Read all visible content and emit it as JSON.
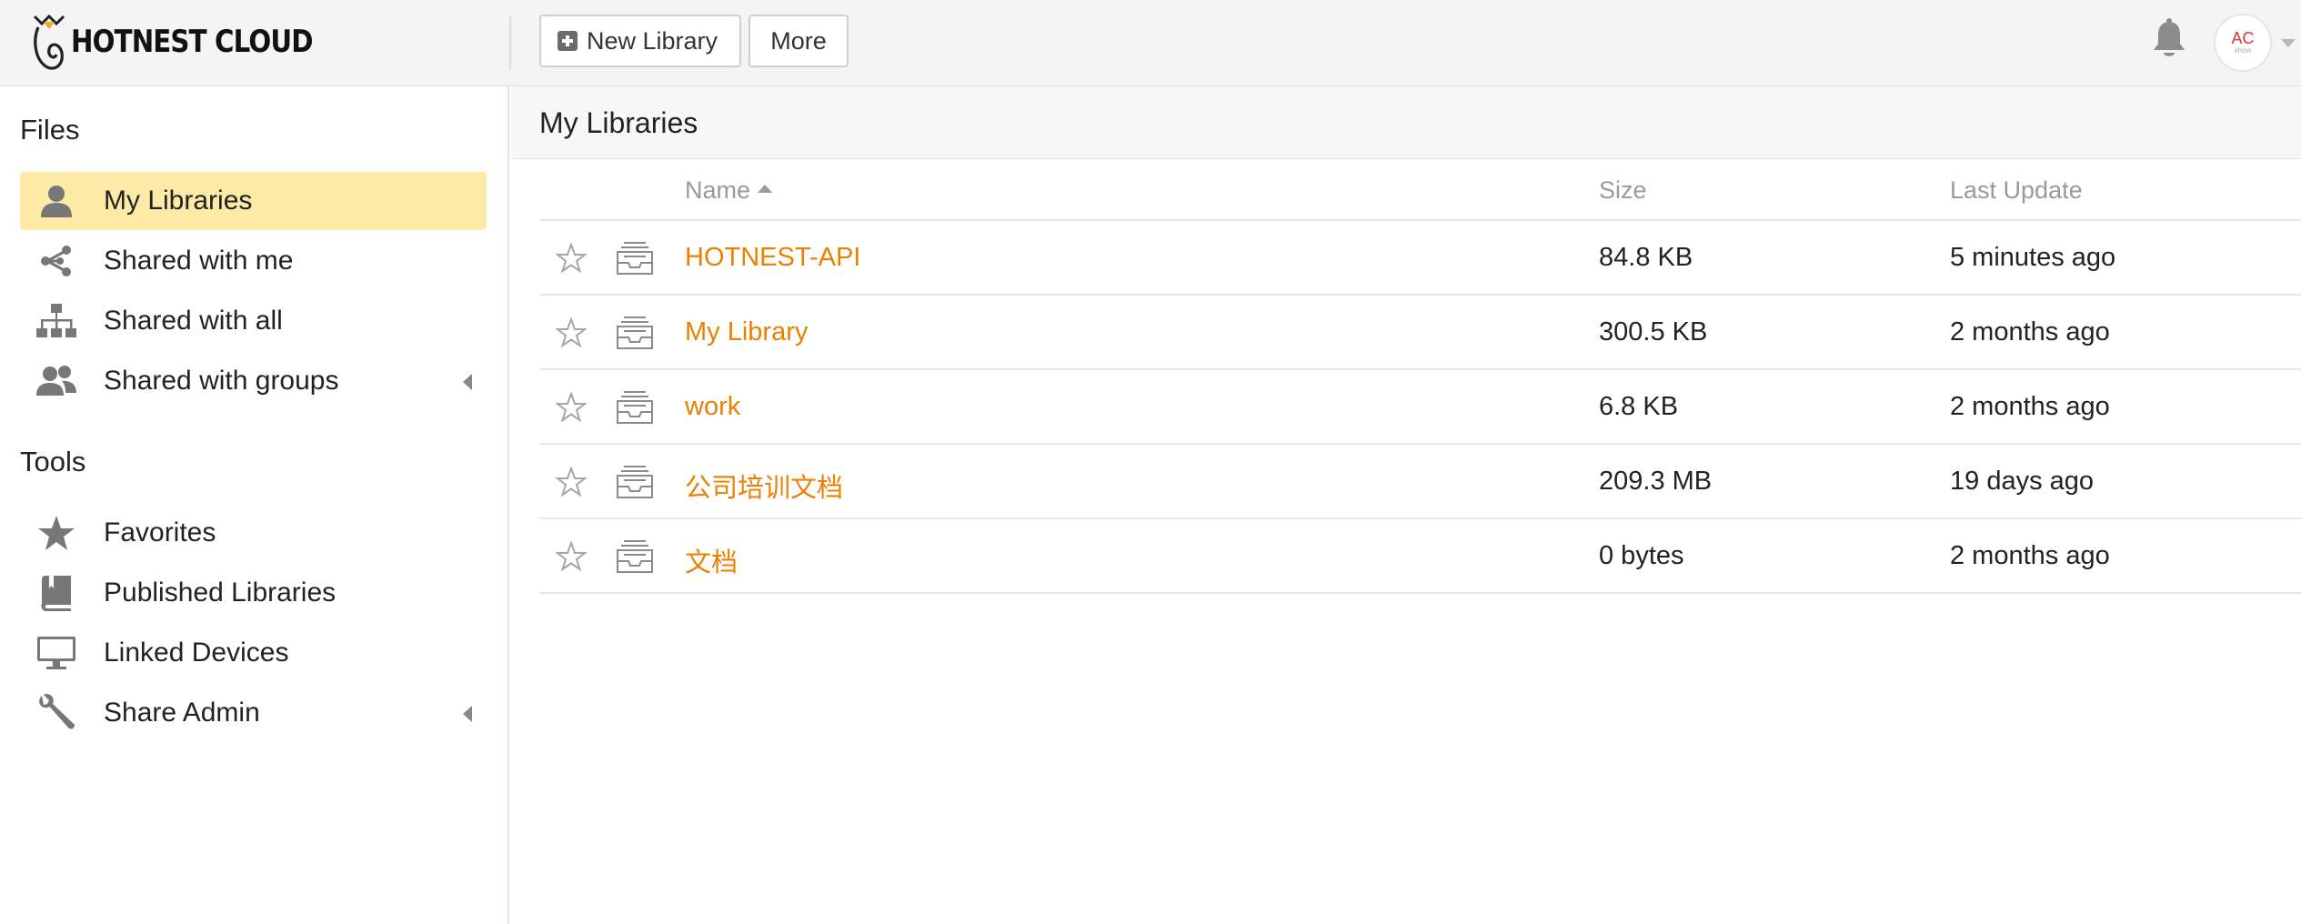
{
  "brand": {
    "name": "HOTNEST CLOUD"
  },
  "toolbar": {
    "new_library_label": "New Library",
    "more_label": "More"
  },
  "user": {
    "avatar_text": "AC",
    "avatar_sub": "show"
  },
  "sidebar": {
    "files_heading": "Files",
    "files_items": [
      {
        "label": "My Libraries",
        "icon": "user-icon",
        "active": true
      },
      {
        "label": "Shared with me",
        "icon": "share-icon"
      },
      {
        "label": "Shared with all",
        "icon": "org-chart-icon"
      },
      {
        "label": "Shared with groups",
        "icon": "group-icon",
        "expandable": true
      }
    ],
    "tools_heading": "Tools",
    "tools_items": [
      {
        "label": "Favorites",
        "icon": "star-icon"
      },
      {
        "label": "Published Libraries",
        "icon": "book-icon"
      },
      {
        "label": "Linked Devices",
        "icon": "monitor-icon"
      },
      {
        "label": "Share Admin",
        "icon": "wrench-icon",
        "expandable": true
      }
    ]
  },
  "main": {
    "title": "My Libraries",
    "columns": {
      "name": "Name",
      "size": "Size",
      "last_update": "Last Update"
    },
    "rows": [
      {
        "name": "HOTNEST-API",
        "size": "84.8 KB",
        "last_update": "5 minutes ago"
      },
      {
        "name": "My Library",
        "size": "300.5 KB",
        "last_update": "2 months ago"
      },
      {
        "name": "work",
        "size": "6.8 KB",
        "last_update": "2 months ago"
      },
      {
        "name": "公司培训文档",
        "size": "209.3 MB",
        "last_update": "19 days ago"
      },
      {
        "name": "文档",
        "size": "0 bytes",
        "last_update": "2 months ago"
      }
    ]
  },
  "colors": {
    "accent": "#ec8000",
    "active_bg": "#fdeaa7",
    "header_bg": "#f4f4f5",
    "icon_gray": "#777777"
  }
}
